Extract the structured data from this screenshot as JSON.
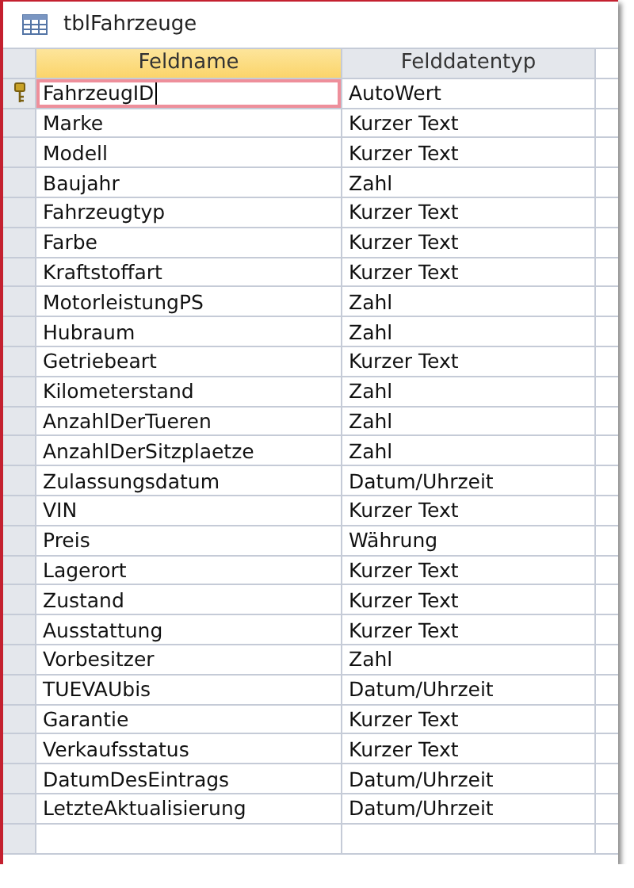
{
  "window": {
    "title": "tblFahrzeuge"
  },
  "table": {
    "columns": [
      {
        "label": "Feldname",
        "selected": true
      },
      {
        "label": "Felddatentyp",
        "selected": false
      }
    ],
    "rows": [
      {
        "name": "FahrzeugID",
        "type": "AutoWert",
        "primary_key": true,
        "selected": true
      },
      {
        "name": "Marke",
        "type": "Kurzer Text",
        "primary_key": false,
        "selected": false
      },
      {
        "name": "Modell",
        "type": "Kurzer Text",
        "primary_key": false,
        "selected": false
      },
      {
        "name": "Baujahr",
        "type": "Zahl",
        "primary_key": false,
        "selected": false
      },
      {
        "name": "Fahrzeugtyp",
        "type": "Kurzer Text",
        "primary_key": false,
        "selected": false
      },
      {
        "name": "Farbe",
        "type": "Kurzer Text",
        "primary_key": false,
        "selected": false
      },
      {
        "name": "Kraftstoffart",
        "type": "Kurzer Text",
        "primary_key": false,
        "selected": false
      },
      {
        "name": "MotorleistungPS",
        "type": "Zahl",
        "primary_key": false,
        "selected": false
      },
      {
        "name": "Hubraum",
        "type": "Zahl",
        "primary_key": false,
        "selected": false
      },
      {
        "name": "Getriebeart",
        "type": "Kurzer Text",
        "primary_key": false,
        "selected": false
      },
      {
        "name": "Kilometerstand",
        "type": "Zahl",
        "primary_key": false,
        "selected": false
      },
      {
        "name": "AnzahlDerTueren",
        "type": "Zahl",
        "primary_key": false,
        "selected": false
      },
      {
        "name": "AnzahlDerSitzplaetze",
        "type": "Zahl",
        "primary_key": false,
        "selected": false
      },
      {
        "name": "Zulassungsdatum",
        "type": "Datum/Uhrzeit",
        "primary_key": false,
        "selected": false
      },
      {
        "name": "VIN",
        "type": "Kurzer Text",
        "primary_key": false,
        "selected": false
      },
      {
        "name": "Preis",
        "type": "Währung",
        "primary_key": false,
        "selected": false
      },
      {
        "name": "Lagerort",
        "type": "Kurzer Text",
        "primary_key": false,
        "selected": false
      },
      {
        "name": "Zustand",
        "type": "Kurzer Text",
        "primary_key": false,
        "selected": false
      },
      {
        "name": "Ausstattung",
        "type": "Kurzer Text",
        "primary_key": false,
        "selected": false
      },
      {
        "name": "Vorbesitzer",
        "type": "Zahl",
        "primary_key": false,
        "selected": false
      },
      {
        "name": "TUEVAUbis",
        "type": "Datum/Uhrzeit",
        "primary_key": false,
        "selected": false
      },
      {
        "name": "Garantie",
        "type": "Kurzer Text",
        "primary_key": false,
        "selected": false
      },
      {
        "name": "Verkaufsstatus",
        "type": "Kurzer Text",
        "primary_key": false,
        "selected": false
      },
      {
        "name": "DatumDesEintrags",
        "type": "Datum/Uhrzeit",
        "primary_key": false,
        "selected": false
      },
      {
        "name": "LetzteAktualisierung",
        "type": "Datum/Uhrzeit",
        "primary_key": false,
        "selected": false
      }
    ]
  }
}
